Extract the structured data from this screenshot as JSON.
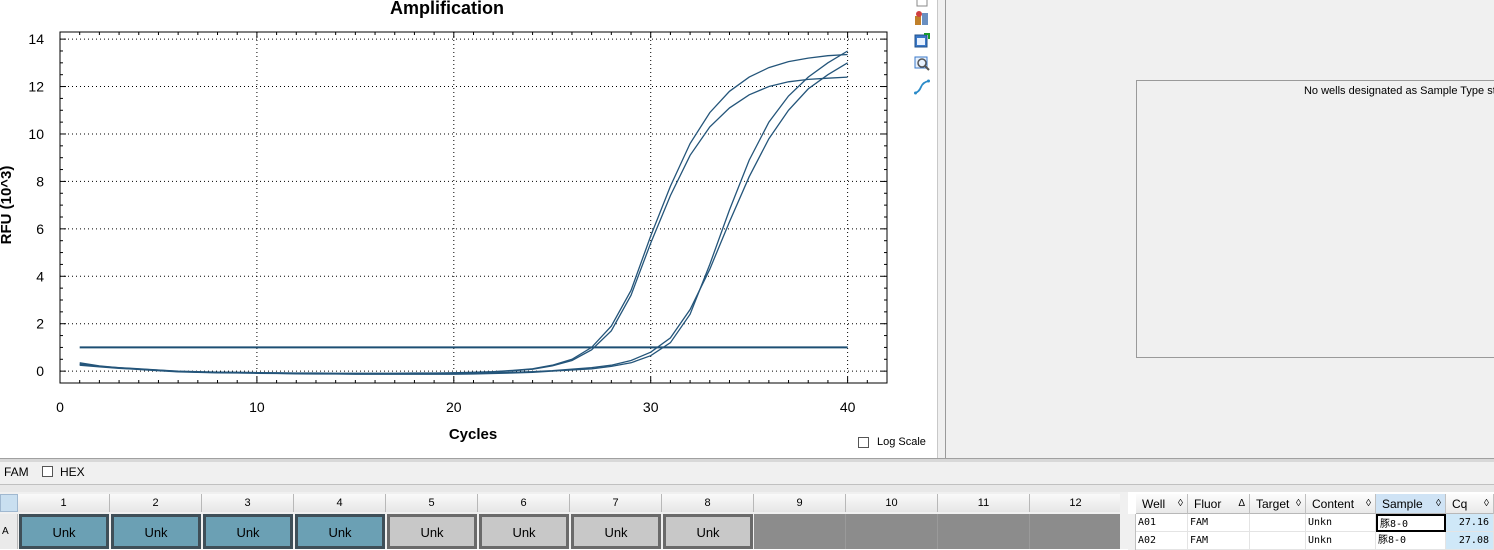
{
  "chart": {
    "log_scale_label": "Log Scale"
  },
  "chart_data": {
    "type": "line",
    "title": "Amplification",
    "xlabel": "Cycles",
    "ylabel": "RFU (10^3)",
    "xlim": [
      0,
      42
    ],
    "ylim": [
      -0.5,
      14.3
    ],
    "xticks": [
      0,
      10,
      20,
      30,
      40
    ],
    "yticks": [
      0,
      2,
      4,
      6,
      8,
      10,
      12,
      14
    ],
    "grid": true,
    "threshold": 1.0,
    "x": [
      1,
      2,
      3,
      4,
      5,
      6,
      7,
      8,
      9,
      10,
      11,
      12,
      13,
      14,
      15,
      16,
      17,
      18,
      19,
      20,
      21,
      22,
      23,
      24,
      25,
      26,
      27,
      28,
      29,
      30,
      31,
      32,
      33,
      34,
      35,
      36,
      37,
      38,
      39,
      40
    ],
    "series": [
      {
        "values": [
          0.3,
          0.2,
          0.15,
          0.1,
          0.05,
          0.0,
          -0.02,
          -0.04,
          -0.05,
          -0.06,
          -0.07,
          -0.08,
          -0.08,
          -0.09,
          -0.09,
          -0.09,
          -0.09,
          -0.08,
          -0.08,
          -0.07,
          -0.05,
          -0.02,
          0.03,
          0.1,
          0.25,
          0.5,
          1.0,
          1.9,
          3.4,
          5.7,
          7.8,
          9.6,
          10.9,
          11.8,
          12.4,
          12.8,
          13.05,
          13.2,
          13.3,
          13.35
        ]
      },
      {
        "values": [
          0.35,
          0.22,
          0.14,
          0.08,
          0.03,
          -0.02,
          -0.04,
          -0.05,
          -0.06,
          -0.07,
          -0.08,
          -0.09,
          -0.09,
          -0.1,
          -0.1,
          -0.1,
          -0.1,
          -0.09,
          -0.09,
          -0.08,
          -0.06,
          -0.03,
          0.02,
          0.08,
          0.22,
          0.45,
          0.9,
          1.7,
          3.2,
          5.4,
          7.4,
          9.1,
          10.3,
          11.1,
          11.65,
          12.0,
          12.2,
          12.3,
          12.35,
          12.4
        ]
      },
      {
        "values": [
          0.25,
          0.18,
          0.12,
          0.07,
          0.02,
          -0.03,
          -0.05,
          -0.07,
          -0.08,
          -0.09,
          -0.1,
          -0.11,
          -0.12,
          -0.12,
          -0.13,
          -0.13,
          -0.13,
          -0.13,
          -0.13,
          -0.13,
          -0.12,
          -0.1,
          -0.08,
          -0.05,
          0.0,
          0.05,
          0.1,
          0.2,
          0.35,
          0.65,
          1.2,
          2.4,
          4.5,
          6.8,
          8.9,
          10.5,
          11.6,
          12.4,
          13.0,
          13.5
        ]
      },
      {
        "values": [
          0.28,
          0.2,
          0.13,
          0.09,
          0.04,
          -0.01,
          -0.04,
          -0.06,
          -0.07,
          -0.08,
          -0.09,
          -0.1,
          -0.1,
          -0.11,
          -0.11,
          -0.11,
          -0.11,
          -0.11,
          -0.1,
          -0.1,
          -0.09,
          -0.07,
          -0.05,
          -0.02,
          0.02,
          0.08,
          0.15,
          0.25,
          0.45,
          0.8,
          1.4,
          2.6,
          4.3,
          6.3,
          8.2,
          9.8,
          11.0,
          11.9,
          12.5,
          13.0
        ]
      }
    ]
  },
  "right_pane": {
    "message": "No wells designated as Sample Type standard"
  },
  "fluor_selector": {
    "items": [
      {
        "label": "FAM",
        "checked": true
      },
      {
        "label": "HEX",
        "checked": false
      }
    ]
  },
  "plate": {
    "columns": [
      "1",
      "2",
      "3",
      "4",
      "5",
      "6",
      "7",
      "8",
      "9",
      "10",
      "11",
      "12"
    ],
    "row_label": "A",
    "wells": [
      {
        "label": "Unk",
        "state": "filled"
      },
      {
        "label": "Unk",
        "state": "filled"
      },
      {
        "label": "Unk",
        "state": "filled"
      },
      {
        "label": "Unk",
        "state": "filled"
      },
      {
        "label": "Unk",
        "state": "gray"
      },
      {
        "label": "Unk",
        "state": "gray"
      },
      {
        "label": "Unk",
        "state": "gray"
      },
      {
        "label": "Unk",
        "state": "gray"
      },
      {
        "label": "",
        "state": "empty"
      },
      {
        "label": "",
        "state": "empty"
      },
      {
        "label": "",
        "state": "empty"
      },
      {
        "label": "",
        "state": "empty"
      }
    ]
  },
  "results_table": {
    "headers": [
      {
        "label": "Well",
        "glyph": "◊"
      },
      {
        "label": "Fluor",
        "glyph": "Δ"
      },
      {
        "label": "Target",
        "glyph": "◊"
      },
      {
        "label": "Content",
        "glyph": "◊"
      },
      {
        "label": "Sample",
        "glyph": "◊"
      },
      {
        "label": "Cq",
        "glyph": "◊"
      }
    ],
    "rows": [
      {
        "well": "A01",
        "fluor": "FAM",
        "target": "",
        "content": "Unkn",
        "sample": "豚8-0",
        "cq": "27.16"
      },
      {
        "well": "A02",
        "fluor": "FAM",
        "target": "",
        "content": "Unkn",
        "sample": "豚8-0",
        "cq": "27.08"
      }
    ]
  }
}
